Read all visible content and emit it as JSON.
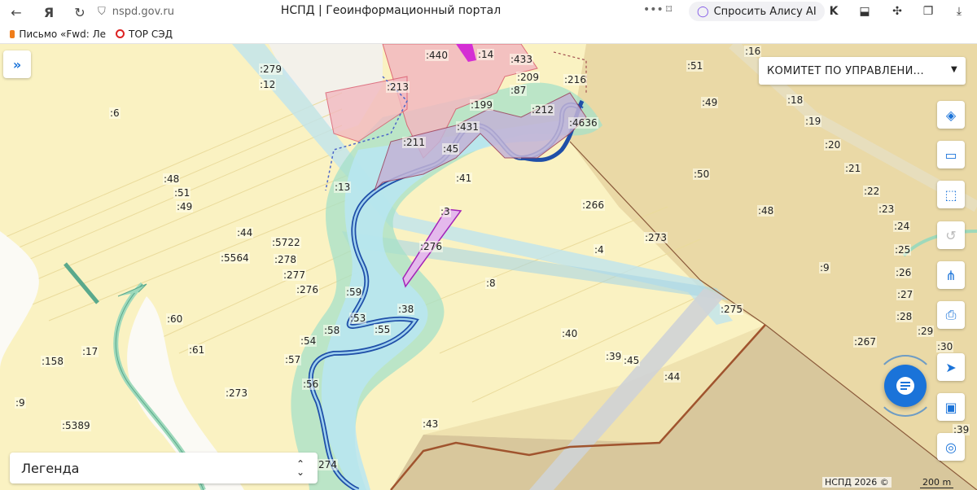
{
  "browser": {
    "url": "nspd.gov.ru",
    "title": "НСПД | Геоинформационный портал",
    "alice_label": "Спросить Алису AI",
    "bookmarks": [
      {
        "label": "Письмо «Fwd: Ле",
        "icon": "mail-icon"
      },
      {
        "label": "ТОР СЭД",
        "icon": "ring-icon"
      }
    ]
  },
  "map_ui": {
    "committee_select": "КОМИТЕТ ПО УПРАВЛЕНИ...",
    "legend_label": "Легенда",
    "copyright": "НСПД 2026 ©",
    "scale_label": "200 m",
    "tools": [
      {
        "name": "layers-icon",
        "glyph": "◈",
        "enabled": true
      },
      {
        "name": "ruler-icon",
        "glyph": "▭",
        "enabled": true
      },
      {
        "name": "area-select-icon",
        "glyph": "⬚",
        "enabled": true
      },
      {
        "name": "history-icon",
        "glyph": "↺",
        "enabled": false
      },
      {
        "name": "share-icon",
        "glyph": "⋔",
        "enabled": true
      },
      {
        "name": "print-icon",
        "glyph": "⎙",
        "enabled": true
      },
      {
        "name": "locate-icon",
        "glyph": "➤",
        "enabled": true
      },
      {
        "name": "frame-icon",
        "glyph": "▣",
        "enabled": true
      },
      {
        "name": "geo-search-icon",
        "glyph": "◎",
        "enabled": true
      }
    ]
  },
  "parcel_labels": [
    {
      "t": ":279"
    },
    {
      "t": ":12"
    },
    {
      "t": ":213"
    },
    {
      "t": ":440"
    },
    {
      "t": ":14"
    },
    {
      "t": ":433"
    },
    {
      "t": ":209"
    },
    {
      "t": ":216"
    },
    {
      "t": ":87"
    },
    {
      "t": ":199"
    },
    {
      "t": ":212"
    },
    {
      "t": ":4636"
    },
    {
      "t": ":431"
    },
    {
      "t": ":211"
    },
    {
      "t": ":45"
    },
    {
      "t": ":41"
    },
    {
      "t": ":6"
    },
    {
      "t": ":48"
    },
    {
      "t": ":51"
    },
    {
      "t": ":49"
    },
    {
      "t": ":13"
    },
    {
      "t": ":3"
    },
    {
      "t": ":266"
    },
    {
      "t": ":44"
    },
    {
      "t": ":5722"
    },
    {
      "t": ":5564"
    },
    {
      "t": ":278"
    },
    {
      "t": ":277"
    },
    {
      "t": ":276"
    },
    {
      "t": ":276"
    },
    {
      "t": ":59"
    },
    {
      "t": ":4"
    },
    {
      "t": ":273"
    },
    {
      "t": ":8"
    },
    {
      "t": ":38"
    },
    {
      "t": ":53"
    },
    {
      "t": ":55"
    },
    {
      "t": ":58"
    },
    {
      "t": ":54"
    },
    {
      "t": ":60"
    },
    {
      "t": ":61"
    },
    {
      "t": ":17"
    },
    {
      "t": ":158"
    },
    {
      "t": ":57"
    },
    {
      "t": ":56"
    },
    {
      "t": ":273"
    },
    {
      "t": ":9"
    },
    {
      "t": ":5389"
    },
    {
      "t": ":40"
    },
    {
      "t": ":39"
    },
    {
      "t": ":45"
    },
    {
      "t": ":44"
    },
    {
      "t": ":43"
    },
    {
      "t": ":274"
    },
    {
      "t": ":275"
    },
    {
      "t": ":51"
    },
    {
      "t": ":16"
    },
    {
      "t": ":49"
    },
    {
      "t": ":18"
    },
    {
      "t": ":19"
    },
    {
      "t": ":20"
    },
    {
      "t": ":50"
    },
    {
      "t": ":21"
    },
    {
      "t": ":22"
    },
    {
      "t": ":48"
    },
    {
      "t": ":23"
    },
    {
      "t": ":24"
    },
    {
      "t": ":25"
    },
    {
      "t": ":9"
    },
    {
      "t": ":26"
    },
    {
      "t": ":27"
    },
    {
      "t": ":28"
    },
    {
      "t": ":29"
    },
    {
      "t": ":267"
    },
    {
      "t": ":30"
    },
    {
      "t": ":39"
    },
    {
      "t": ":273"
    }
  ]
}
